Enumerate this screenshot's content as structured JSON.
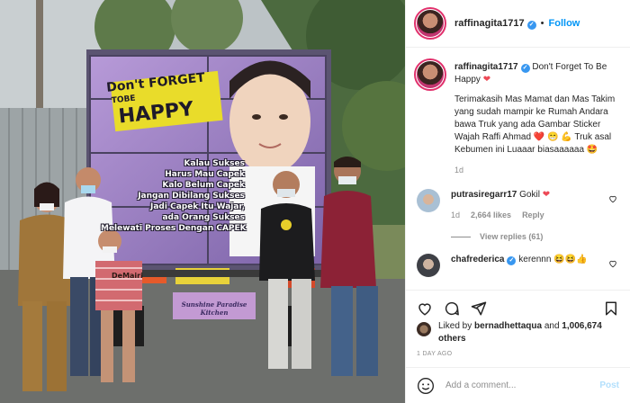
{
  "post": {
    "username": "raffinagita1717",
    "follow_label": "Follow",
    "separator": "•"
  },
  "photo": {
    "truck_headline_top": "Don't FORGET",
    "truck_headline_mid": "TOBE",
    "truck_headline_big": "HAPPY",
    "truck_lines": [
      "Kalau Sukses",
      "Harus Mau Capek",
      "Kalo Belum Capek",
      "Jangan Dibilang Sukses",
      "Jadi Capek Itu Wajar,",
      "ada Orang Sukses",
      "Melewati Proses Dengan CAPEK"
    ],
    "bumper_label": "DeMairi",
    "plate_text": "Sunshine Paradise Kitchen"
  },
  "caption": {
    "username": "raffinagita1717",
    "line1": "Don't Forget To Be Happy",
    "line2": "Terimakasih Mas Mamat dan Mas Takim yang sudah mampir ke Rumah Andara bawa Truk yang ada Gambar Sticker Wajah Raffi Ahmad",
    "line2_emoji": "❤️ 😁 💪",
    "line3": "Truk asal Kebumen ini Luaaar biasaaaaaa",
    "line3_emoji": "🤩",
    "time": "1d"
  },
  "comment1": {
    "username": "putrasiregarr17",
    "text": "Gokil",
    "time": "1d",
    "likes": "2,664 likes",
    "reply_label": "Reply",
    "view_replies": "View replies (61)"
  },
  "comment2": {
    "username": "chafrederica",
    "text": "kerennn",
    "emoji": "😆😆👍"
  },
  "likes": {
    "prefix": "Liked by",
    "user": "bernadhettaqua",
    "and": "and",
    "count": "1,006,674 others"
  },
  "time_ago": "1 DAY AGO",
  "add_comment": {
    "placeholder": "Add a comment...",
    "post_label": "Post"
  },
  "colors": {
    "verified": "#3897f0",
    "follow": "#0095f6",
    "like_red": "#ed4956"
  },
  "icons": [
    "heart-icon",
    "comment-icon",
    "share-icon",
    "bookmark-icon",
    "emoji-icon",
    "verified-icon"
  ]
}
